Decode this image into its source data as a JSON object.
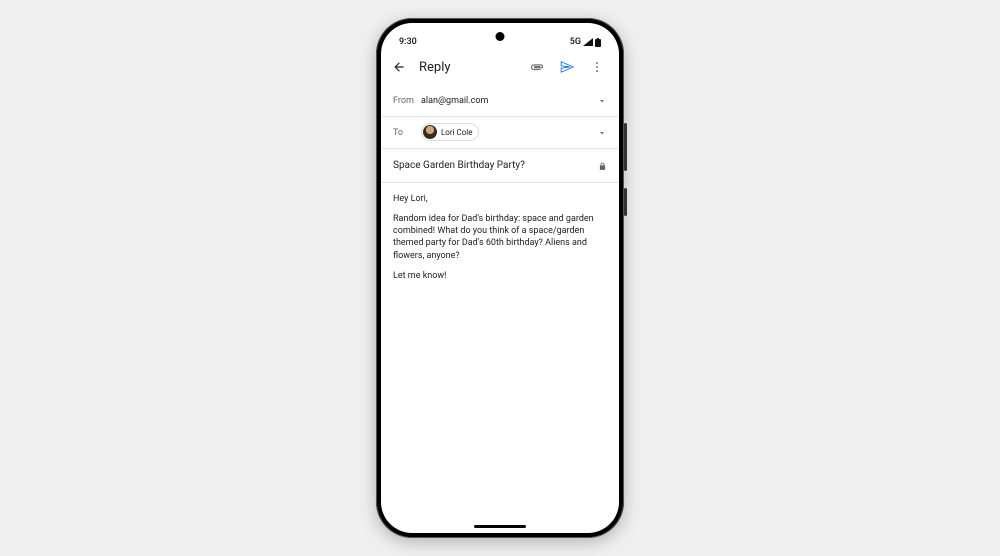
{
  "status": {
    "time": "9:30",
    "network": "5G"
  },
  "appbar": {
    "title": "Reply"
  },
  "from": {
    "label": "From",
    "value": "alan@gmail.com"
  },
  "to": {
    "label": "To",
    "recipient": "Lori Cole"
  },
  "subject": "Space Garden Birthday Party?",
  "body": {
    "p1": "Hey Lori,",
    "p2": "Random idea for Dad's birthday: space and garden combined! What do you think of a space/garden themed party for Dad's 60th birthday? Aliens and flowers, anyone?",
    "p3": "Let me know!"
  }
}
